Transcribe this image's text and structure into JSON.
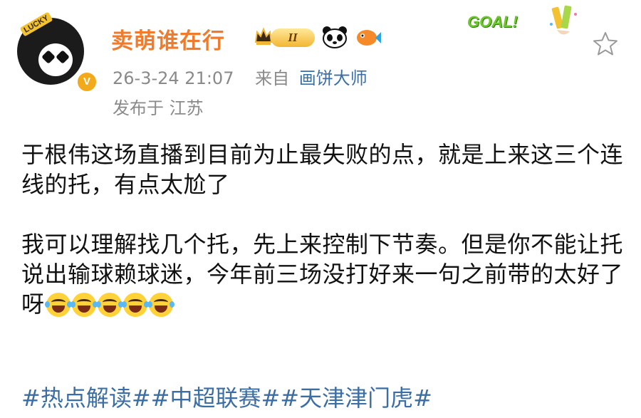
{
  "post": {
    "author": {
      "name": "卖萌谁在行",
      "avatar_badge_text": "LUCKY",
      "verified_mark": "V",
      "vip_level": "II"
    },
    "timestamp": "26-3-24 21:07",
    "source_prefix": "来自",
    "source_app": "画饼大师",
    "location": "发布于 江苏",
    "decoration_text": "GOAL!",
    "paragraphs": [
      "于根伟这场直播到目前为止最失败的点，就是上来这三个连线的托，有点太尬了",
      "我可以理解找几个托，先上来控制下节奏。但是你不能让托说出输球赖球迷，今年前三场没打好来一句之前带的太好了呀"
    ],
    "emoji": [
      "laugh-cry-icon",
      "laugh-cry-icon",
      "laugh-cry-icon",
      "laugh-cry-icon",
      "laugh-cry-icon"
    ],
    "hashtags": [
      "#热点解读#",
      "#中超联赛#",
      "#天津津门虎#"
    ]
  },
  "colors": {
    "username": "#ef7b2c",
    "link": "#3a6ea5",
    "meta": "#8a8a8a",
    "text": "#111111"
  },
  "icons": {
    "favorite": "star-outline-icon",
    "crown": "crown-icon",
    "panda": "panda-badge-icon",
    "fish": "fish-badge-icon"
  }
}
